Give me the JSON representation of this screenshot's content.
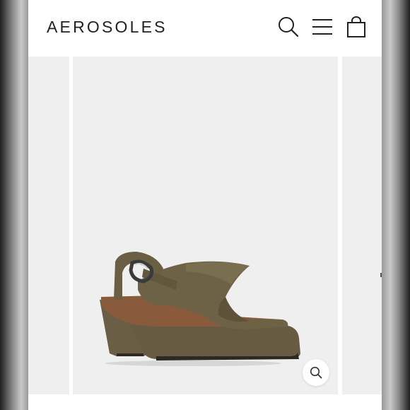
{
  "header": {
    "brand": "AEROSOLES",
    "icons": {
      "search": "search-icon",
      "menu": "hamburger-menu-icon",
      "cart": "shopping-bag-icon"
    }
  },
  "gallery": {
    "product_image": "olive-suede-slingback-platform-sandal",
    "zoom_icon": "zoom-magnifier-icon"
  },
  "colors": {
    "page_background": "#ffffff",
    "slide_background": "#efefef",
    "text": "#222222",
    "product_suede": "#6e6246"
  }
}
